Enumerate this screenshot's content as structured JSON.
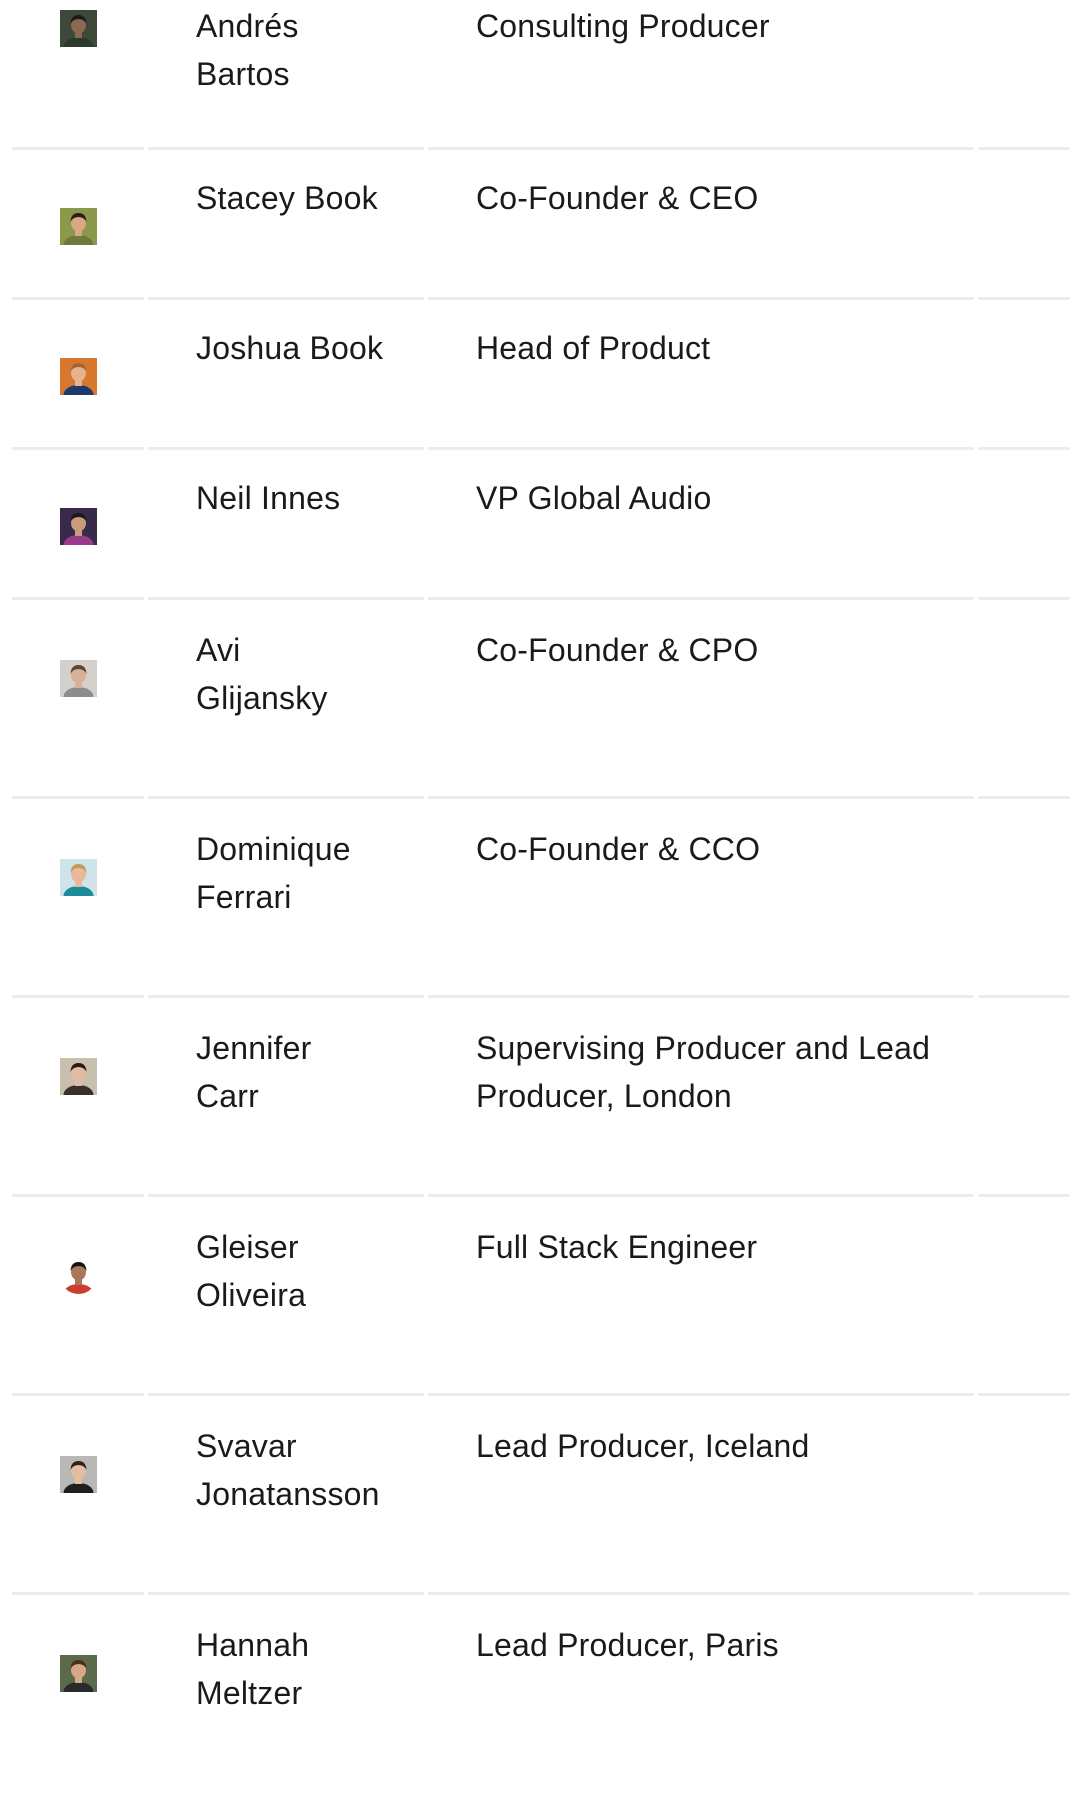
{
  "team": [
    {
      "name_line1": "Andrés",
      "name_line2": "Bartos",
      "role_line1": "Consulting Producer",
      "role_line2": "",
      "avatar": {
        "icon": "person-photo",
        "bg": "#3d4a3a",
        "skin": "#8a6a52",
        "hair": "#1f1a17",
        "shirt": "#2c3a2e"
      }
    },
    {
      "name_line1": "Stacey Book",
      "name_line2": "",
      "role_line1": "Co-Founder & CEO",
      "role_line2": "",
      "avatar": {
        "icon": "person-photo",
        "bg": "#8a9a4a",
        "skin": "#d7a982",
        "hair": "#2a1e18",
        "shirt": "#6d7a3d"
      }
    },
    {
      "name_line1": "Joshua Book",
      "name_line2": "",
      "role_line1": "Head of Product",
      "role_line2": "",
      "avatar": {
        "icon": "person-photo",
        "bg": "#d8782e",
        "skin": "#e3b48e",
        "hair": "#a8642e",
        "shirt": "#1f3a6a"
      }
    },
    {
      "name_line1": "Neil Innes",
      "name_line2": "",
      "role_line1": "VP Global Audio",
      "role_line2": "",
      "avatar": {
        "icon": "person-photo",
        "bg": "#3a2a4a",
        "skin": "#c89a7e",
        "hair": "#1a1a1a",
        "shirt": "#9a3a8a"
      }
    },
    {
      "name_line1": "Avi",
      "name_line2": "Glijansky",
      "role_line1": "Co-Founder & CPO",
      "role_line2": "",
      "avatar": {
        "icon": "person-photo",
        "bg": "#d4d0cc",
        "skin": "#d9b197",
        "hair": "#5a4636",
        "shirt": "#8c8c8c"
      }
    },
    {
      "name_line1": "Dominique",
      "name_line2": "Ferrari",
      "role_line1": "Co-Founder & CCO",
      "role_line2": "",
      "avatar": {
        "icon": "person-photo",
        "bg": "#cfe3ea",
        "skin": "#e8b99a",
        "hair": "#c49a5a",
        "shirt": "#1d8c9a"
      }
    },
    {
      "name_line1": "Jennifer",
      "name_line2": "Carr",
      "role_line1": "Supervising Producer and Lead",
      "role_line2": "Producer, London",
      "avatar": {
        "icon": "person-photo",
        "bg": "#c9bfae",
        "skin": "#e0bda2",
        "hair": "#2a1a14",
        "shirt": "#3a2e2a"
      }
    },
    {
      "name_line1": "Gleiser",
      "name_line2": "Oliveira",
      "role_line1": "Full Stack Engineer",
      "role_line2": "",
      "avatar": {
        "icon": "person-photo",
        "bg": "#ffffff",
        "skin": "#a8785a",
        "hair": "#1a1410",
        "shirt": "#cc3d2e"
      }
    },
    {
      "name_line1": "Svavar",
      "name_line2": "Jonatansson",
      "role_line1": "Lead Producer, Iceland",
      "role_line2": "",
      "avatar": {
        "icon": "person-photo",
        "bg": "#b8b8b4",
        "skin": "#e4bda0",
        "hair": "#2a2420",
        "shirt": "#1e1e1e"
      }
    },
    {
      "name_line1": "Hannah",
      "name_line2": "Meltzer",
      "role_line1": "Lead Producer, Paris",
      "role_line2": "",
      "avatar": {
        "icon": "person-photo",
        "bg": "#5a6a4a",
        "skin": "#d8a886",
        "hair": "#4a2e1e",
        "shirt": "#2a2a2a"
      }
    }
  ]
}
